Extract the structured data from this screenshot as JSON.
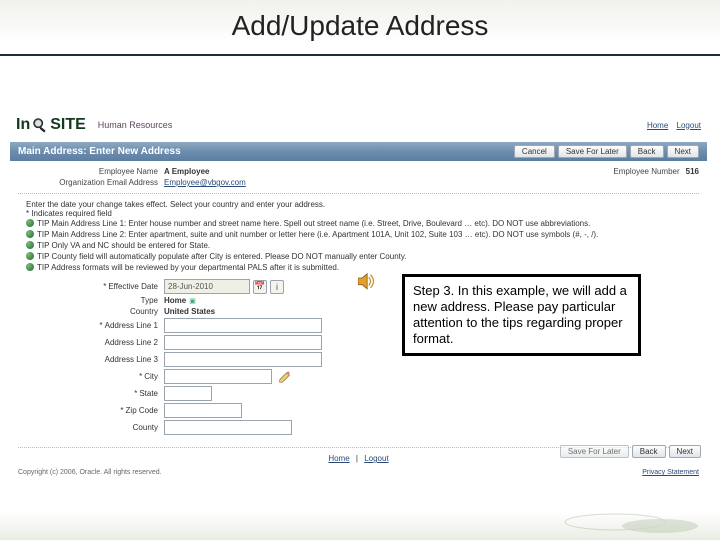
{
  "slide_title": "Add/Update Address",
  "logo": {
    "pre": "In",
    "post": "SITE",
    "sub": "Human Resources"
  },
  "header_links": {
    "home": "Home",
    "logout": "Logout"
  },
  "bar_title": "Main Address: Enter New Address",
  "buttons": {
    "cancel": "Cancel",
    "save": "Save For Later",
    "back": "Back",
    "next": "Next"
  },
  "meta": {
    "emp_name_lbl": "Employee Name",
    "emp_name_val": "A Employee",
    "org_email_lbl": "Organization Email Address",
    "org_email_val": "Employee@vbgov.com",
    "emp_no_lbl": "Employee Number",
    "emp_no_val": "516"
  },
  "instructions": {
    "intro": "Enter the date your change takes effect. Select your country and enter your address.",
    "req": "* Indicates required field",
    "tips": [
      "TIP Main Address Line 1: Enter house number and street name here. Spell out street name (i.e. Street, Drive, Boulevard … etc). DO NOT use abbreviations.",
      "TIP Main Address Line 2: Enter apartment, suite and unit number or letter here (i.e. Apartment 101A, Unit 102, Suite 103 … etc). DO NOT use symbols (#, -, /).",
      "TIP Only VA and NC should be entered for State.",
      "TIP County field will automatically populate after City is entered. Please DO NOT manually enter County.",
      "TIP Address formats will be reviewed by your departmental PALS after it is submitted."
    ]
  },
  "form": {
    "eff_date_lbl": "Effective Date",
    "eff_date_val": "28-Jun-2010",
    "type_lbl": "Type",
    "type_val": "Home",
    "country_lbl": "Country",
    "country_val": "United States",
    "addr1_lbl": "Address Line 1",
    "addr2_lbl": "Address Line 2",
    "addr3_lbl": "Address Line 3",
    "city_lbl": "City",
    "state_lbl": "State",
    "zip_lbl": "Zip Code",
    "county_lbl": "County"
  },
  "footer": {
    "home": "Home",
    "logout": "Logout",
    "copyright": "Copyright (c) 2006, Oracle. All rights reserved.",
    "privacy": "Privacy Statement"
  },
  "callout": "Step 3. In this example, we will add a new address. Please pay particular attention to the tips regarding proper format."
}
